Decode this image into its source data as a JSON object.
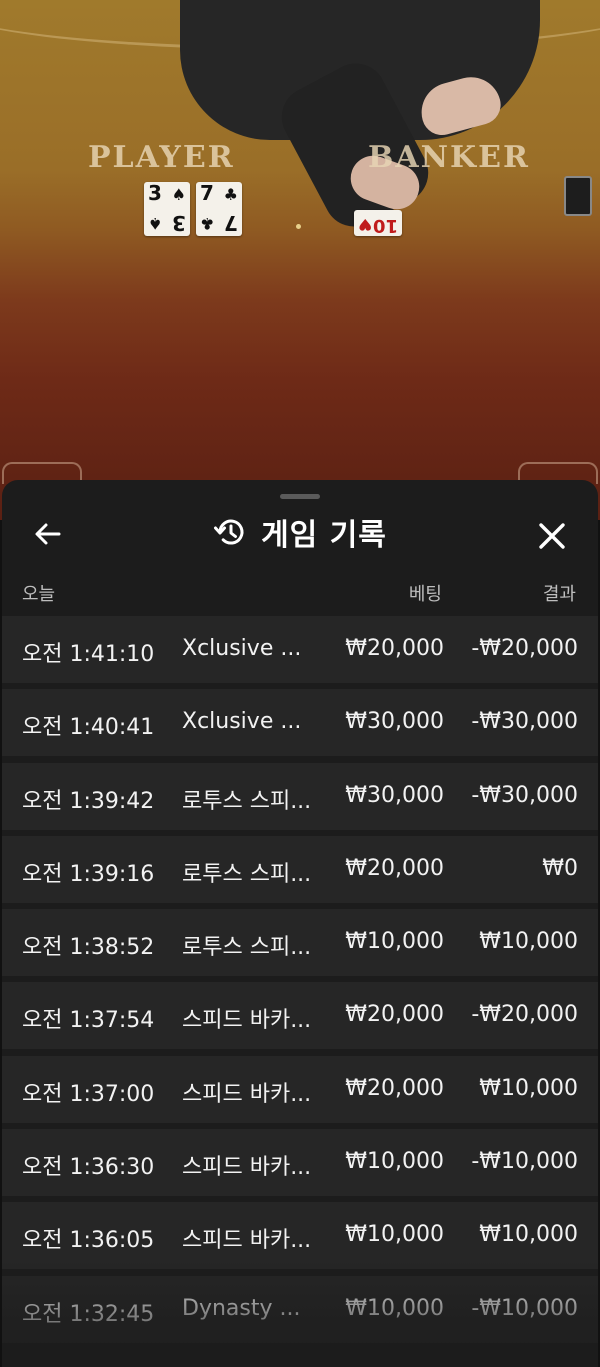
{
  "table": {
    "player_label": "PLAYER",
    "banker_label": "BANKER",
    "player_cards": [
      {
        "rank": "3",
        "suit": "♠",
        "suit_name": "spades",
        "color": "black"
      },
      {
        "rank": "7",
        "suit": "♣",
        "suit_name": "clubs",
        "color": "black"
      }
    ],
    "banker_cards": [
      {
        "rank": "10",
        "suit": "♥",
        "suit_name": "hearts",
        "color": "red"
      }
    ]
  },
  "sheet": {
    "title": "게임 기록",
    "back_icon": "arrow-left-icon",
    "history_icon": "history-clock-icon",
    "close_icon": "close-icon"
  },
  "columns": {
    "date": "오늘",
    "bet": "베팅",
    "result": "결과"
  },
  "history": [
    {
      "time": "오전 1:41:10",
      "game": "Xclusive ...",
      "bet": "₩20,000",
      "result": "-₩20,000"
    },
    {
      "time": "오전 1:40:41",
      "game": "Xclusive ...",
      "bet": "₩30,000",
      "result": "-₩30,000"
    },
    {
      "time": "오전 1:39:42",
      "game": "로투스 스피...",
      "bet": "₩30,000",
      "result": "-₩30,000"
    },
    {
      "time": "오전 1:39:16",
      "game": "로투스 스피...",
      "bet": "₩20,000",
      "result": "₩0"
    },
    {
      "time": "오전 1:38:52",
      "game": "로투스 스피...",
      "bet": "₩10,000",
      "result": "₩10,000"
    },
    {
      "time": "오전 1:37:54",
      "game": "스피드 바카...",
      "bet": "₩20,000",
      "result": "-₩20,000"
    },
    {
      "time": "오전 1:37:00",
      "game": "스피드 바카...",
      "bet": "₩20,000",
      "result": "₩10,000"
    },
    {
      "time": "오전 1:36:30",
      "game": "스피드 바카...",
      "bet": "₩10,000",
      "result": "-₩10,000"
    },
    {
      "time": "오전 1:36:05",
      "game": "스피드 바카...",
      "bet": "₩10,000",
      "result": "₩10,000"
    },
    {
      "time": "오전 1:32:45",
      "game": "Dynasty ...",
      "bet": "₩10,000",
      "result": "-₩10,000"
    }
  ],
  "colors": {
    "sheet_bg": "#1c1c1c",
    "row_bg": "#262626",
    "text": "#f2f2f2",
    "muted": "#bdbdbd"
  }
}
